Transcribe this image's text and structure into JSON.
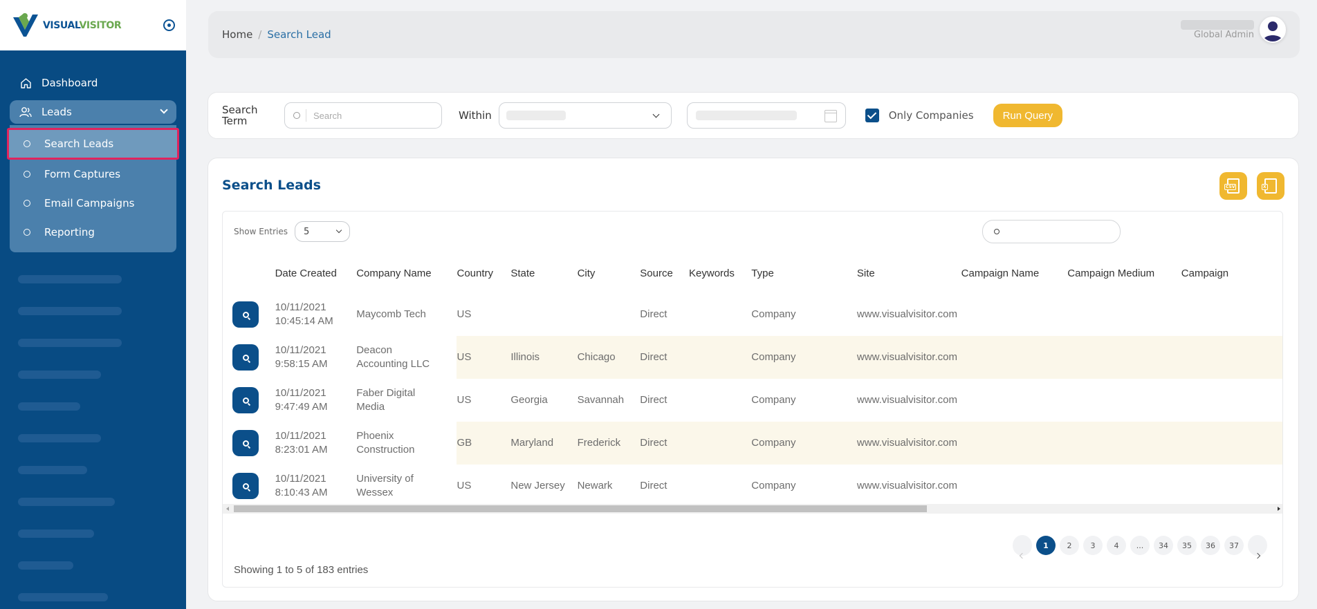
{
  "brand": {
    "logo_part1": "VISUAL",
    "logo_part2": "VISITOR",
    "colors": {
      "sidebar": "#084b83",
      "accent": "#f0b830",
      "primary": "#0b4f8a",
      "highlight": "#e0245e"
    }
  },
  "sidebar": {
    "dashboard_label": "Dashboard",
    "leads_label": "Leads",
    "sub_items": [
      {
        "label": "Search Leads",
        "active": true
      },
      {
        "label": "Form Captures",
        "active": false
      },
      {
        "label": "Email Campaigns",
        "active": false
      },
      {
        "label": "Reporting",
        "active": false
      }
    ]
  },
  "header": {
    "breadcrumb_home": "Home",
    "breadcrumb_separator": "/",
    "breadcrumb_current": "Search Lead",
    "user_role": "Global Admin"
  },
  "search_bar": {
    "term_label": "Search Term",
    "search_placeholder": "Search",
    "within_label": "Within",
    "only_companies_label": "Only Companies",
    "only_companies_checked": true,
    "run_button_label": "Run Query"
  },
  "card": {
    "title": "Search Leads",
    "export_icons": [
      "csv-export-icon",
      "excel-export-icon"
    ],
    "show_entries_label": "Show Entries",
    "show_entries_value": "5",
    "columns": [
      "Date Created",
      "Company Name",
      "Country",
      "State",
      "City",
      "Source",
      "Keywords",
      "Type",
      "Site",
      "Campaign Name",
      "Campaign Medium",
      "Campaign"
    ],
    "rows": [
      {
        "date": "10/11/2021",
        "time": "10:45:14 AM",
        "company1": "Maycomb Tech",
        "company2": "",
        "country": "US",
        "state": "",
        "city": "",
        "source": "Direct",
        "keywords": "",
        "type": "Company",
        "site": "www.visualvisitor.com"
      },
      {
        "date": "10/11/2021",
        "time": "9:58:15 AM",
        "company1": "Deacon",
        "company2": "Accounting LLC",
        "country": "US",
        "state": "Illinois",
        "city": "Chicago",
        "source": "Direct",
        "keywords": "",
        "type": "Company",
        "site": "www.visualvisitor.com"
      },
      {
        "date": "10/11/2021",
        "time": "9:47:49 AM",
        "company1": "Faber Digital",
        "company2": "Media",
        "country": "US",
        "state": "Georgia",
        "city": "Savannah",
        "source": "Direct",
        "keywords": "",
        "type": "Company",
        "site": "www.visualvisitor.com"
      },
      {
        "date": "10/11/2021",
        "time": "8:23:01 AM",
        "company1": "Phoenix",
        "company2": "Construction",
        "country": "GB",
        "state": "Maryland",
        "city": "Frederick",
        "source": "Direct",
        "keywords": "",
        "type": "Company",
        "site": "www.visualvisitor.com"
      },
      {
        "date": "10/11/2021",
        "time": "8:10:43 AM",
        "company1": "University of",
        "company2": "Wessex",
        "country": "US",
        "state": "New Jersey",
        "city": "Newark",
        "source": "Direct",
        "keywords": "",
        "type": "Company",
        "site": "www.visualvisitor.com"
      }
    ],
    "pagination": [
      "1",
      "2",
      "3",
      "4",
      "...",
      "34",
      "35",
      "36",
      "37"
    ],
    "current_page": "1",
    "showing_text": "Showing 1 to 5 of 183 entries"
  }
}
